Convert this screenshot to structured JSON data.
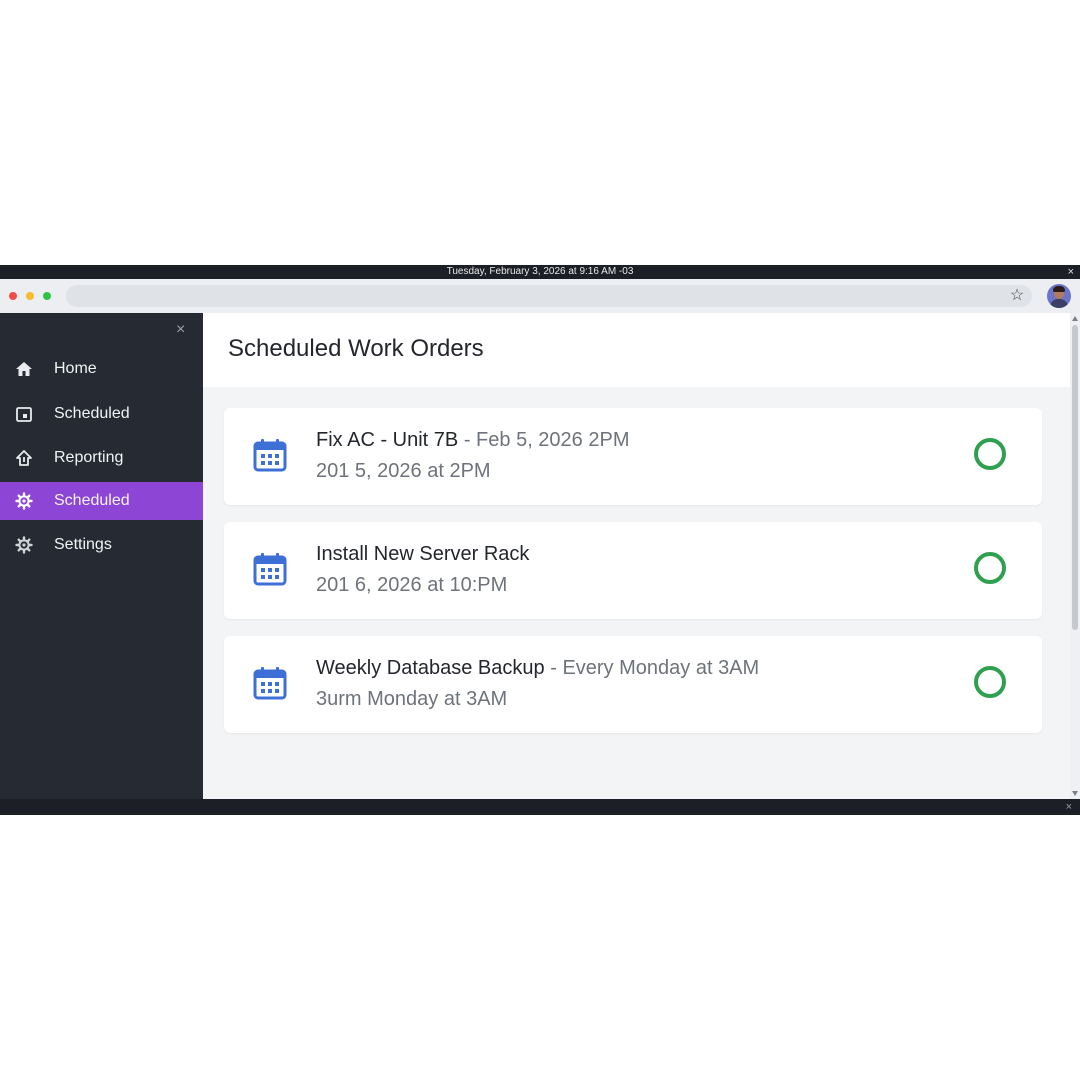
{
  "os_bar": {
    "datetime": "Tuesday, February 3, 2026 at 9:16 AM -03",
    "close": "×"
  },
  "browser": {
    "url": "",
    "star_icon": "star-icon",
    "avatar": "user-avatar"
  },
  "sidebar": {
    "close": "×",
    "items": [
      {
        "label": "Home",
        "icon": "home-icon",
        "active": false
      },
      {
        "label": "Scheduled",
        "icon": "calendar-square-icon",
        "active": false
      },
      {
        "label": "Reporting",
        "icon": "reporting-icon",
        "active": false
      },
      {
        "label": "Scheduled",
        "icon": "gear-icon",
        "active": true
      },
      {
        "label": "Settings",
        "icon": "gear-icon",
        "active": false
      }
    ]
  },
  "main": {
    "title": "Scheduled Work Orders",
    "cards": [
      {
        "title": "Fix AC - Unit 7B",
        "separator": " - ",
        "meta": "Feb 5, 2026 2PM",
        "subtitle": "201 5, 2026 at 2PM",
        "status": "open"
      },
      {
        "title": "Install New Server Rack",
        "separator": "",
        "meta": "",
        "subtitle": "201 6, 2026 at 10:PM",
        "status": "open"
      },
      {
        "title": "Weekly Database Backup",
        "separator": " - ",
        "meta": "Every Monday at 3AM",
        "subtitle": "3urm Monday at 3AM",
        "status": "open"
      }
    ]
  },
  "bottom_bar": {
    "close": "×"
  },
  "colors": {
    "sidebar_bg": "#252a33",
    "active_nav": "#8d45d6",
    "calendar_icon": "#3d6fd6",
    "status_ring": "#2ea04f"
  }
}
